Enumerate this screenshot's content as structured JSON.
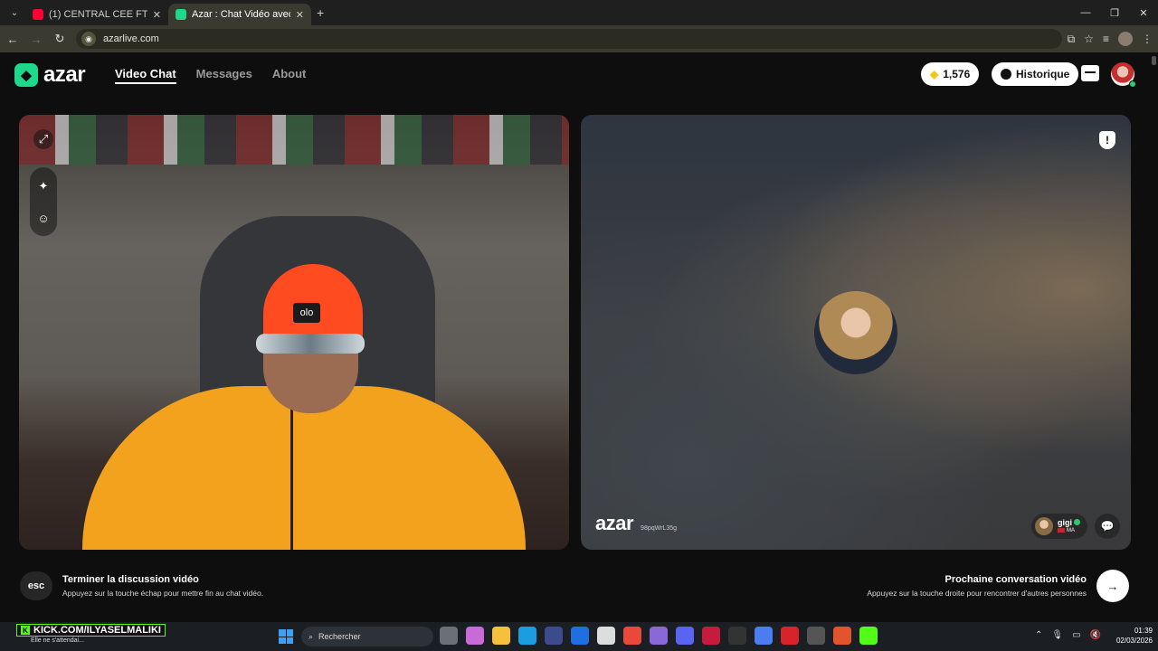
{
  "browser": {
    "tabs": [
      {
        "title": "(1) CENTRAL CEE FT. LIL BABY -",
        "favicon_color": "#ff0033",
        "active": false
      },
      {
        "title": "Azar : Chat Vidéo avec de n",
        "favicon_color": "#1ed98a",
        "active": true
      }
    ],
    "url": "azarlive.com"
  },
  "app": {
    "logo_text": "azar",
    "nav": {
      "video_chat": "Video Chat",
      "messages": "Messages",
      "about": "About"
    },
    "gems": "1,576",
    "history": "Historique",
    "brand_color": "#1ed98a"
  },
  "local_video": {
    "beanie_text": "olo"
  },
  "remote_video": {
    "watermark": "azar",
    "session_id": "98pqWrL35g",
    "peer_name": "gigi",
    "peer_country": "MA"
  },
  "hints": {
    "esc_key": "esc",
    "end_title": "Terminer la discussion vidéo",
    "end_sub": "Appuyez sur la touche échap pour mettre fin au chat vidéo.",
    "next_title": "Prochaine conversation vidéo",
    "next_sub": "Appuyez sur la touche droite pour rencontrer d'autres personnes"
  },
  "taskbar": {
    "kick_overlay": "KICK.COM/ILYASELMALIKI",
    "widget_text": "Elle ne s'attendai...",
    "search": "Rechercher",
    "time": "01:39",
    "date": "02/03/2026"
  }
}
